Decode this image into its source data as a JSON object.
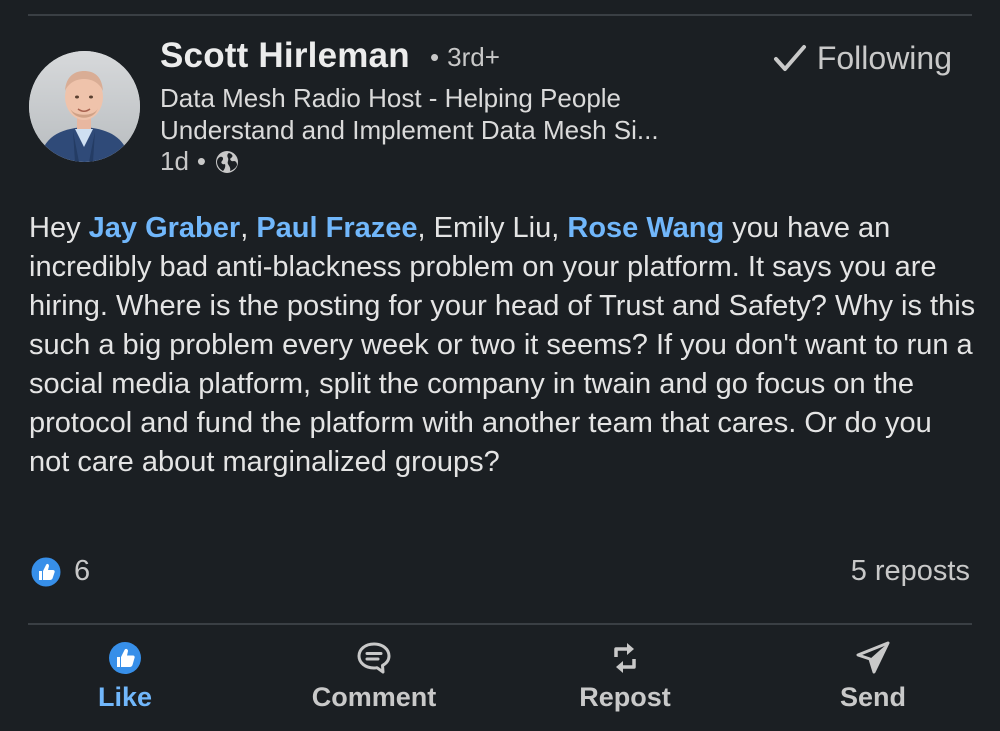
{
  "author": {
    "name": "Scott Hirleman",
    "degree_separator": "•",
    "degree": "3rd+",
    "headline": "Data Mesh Radio Host - Helping People Understand and Implement Data Mesh Si...",
    "time": "1d",
    "time_separator": "•",
    "visibility_icon": "globe-icon"
  },
  "follow": {
    "label": "Following",
    "icon": "checkmark-icon"
  },
  "post": {
    "greeting": "Hey ",
    "mention_1": "Jay Graber",
    "sep_1": ", ",
    "mention_2": "Paul Frazee",
    "sep_2": ", Emily Liu, ",
    "mention_3": "Rose Wang",
    "rest": " you have an incredibly bad anti-blackness problem on your platform. It says you are hiring. Where is the posting for your head of Trust and Safety? Why is this such a big problem every week or two it seems? If you don't want to run a social media platform, split the company in twain and go focus on the protocol and fund the platform with another team that cares. Or do you not care about marginalized groups?"
  },
  "stats": {
    "reaction_count": "6",
    "reaction_icon": "like-reaction-icon",
    "reposts": "5 reposts"
  },
  "actions": {
    "like": "Like",
    "comment": "Comment",
    "repost": "Repost",
    "send": "Send"
  },
  "colors": {
    "background": "#1b1f23",
    "accent": "#71b7fb",
    "like_blue": "#378fe9",
    "text": "#e4e4e4",
    "muted": "#c8c8c8"
  }
}
